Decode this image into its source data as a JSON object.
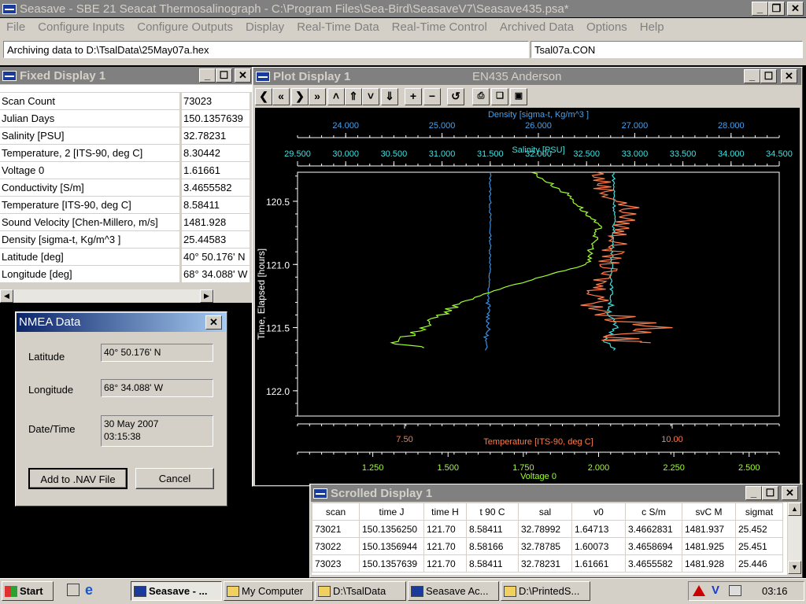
{
  "app": {
    "title": "Seasave - SBE 21 Seacat Thermosalinograph - C:\\Program Files\\Sea-Bird\\SeasaveV7\\Seasave435.psa*",
    "menus": [
      "File",
      "Configure Inputs",
      "Configure Outputs",
      "Display",
      "Real-Time Data",
      "Real-Time Control",
      "Archived Data",
      "Options",
      "Help"
    ],
    "status_left": "Archiving data to D:\\TsalData\\25May07a.hex",
    "status_right": "Tsal07a.CON"
  },
  "fixed_display": {
    "title": "Fixed Display 1",
    "rows": [
      {
        "label": "Scan Count",
        "value": "73023"
      },
      {
        "label": "Julian Days",
        "value": "150.1357639"
      },
      {
        "label": "Salinity [PSU]",
        "value": "32.78231"
      },
      {
        "label": "Temperature, 2 [ITS-90, deg C]",
        "value": "8.30442"
      },
      {
        "label": "Voltage 0",
        "value": "1.61661"
      },
      {
        "label": "Conductivity [S/m]",
        "value": "3.4655582"
      },
      {
        "label": "Temperature [ITS-90, deg C]",
        "value": "8.58411"
      },
      {
        "label": "Sound Velocity [Chen-Millero, m/s]",
        "value": "1481.928"
      },
      {
        "label": "Density [sigma-t, Kg/m^3 ]",
        "value": "25.44583"
      },
      {
        "label": "Latitude [deg]",
        "value": " 40° 50.176' N"
      },
      {
        "label": "Longitude [deg]",
        "value": " 68° 34.088' W"
      }
    ]
  },
  "nmea": {
    "title": "NMEA Data",
    "latitude_label": "Latitude",
    "latitude": "40° 50.176' N",
    "longitude_label": "Longitude",
    "longitude": "68° 34.088' W",
    "datetime_label": "Date/Time",
    "date": "30 May 2007",
    "time": "03:15:38",
    "add_button": "Add to .NAV File",
    "cancel_button": "Cancel"
  },
  "plot_display": {
    "title": "Plot Display 1",
    "subtitle": "EN435 Anderson",
    "toolbar": [
      "❮",
      "«",
      "❯",
      "»",
      "˄",
      "⇑",
      "˅",
      "⇓",
      "+",
      "−",
      "↺",
      "print",
      "copy",
      "save"
    ]
  },
  "chart_data": {
    "type": "line",
    "ylabel": "Time, Elapsed [hours]",
    "y_ticks": [
      "120.5",
      "121.0",
      "121.5",
      "122.0"
    ],
    "ylim": [
      120.27,
      122.2
    ],
    "y_inverted": true,
    "axes": [
      {
        "label": "Density [sigma-t, Kg/m^3 ]",
        "ticks": [
          "24.000",
          "25.000",
          "26.000",
          "27.000",
          "28.000"
        ],
        "range": [
          23.5,
          28.5
        ],
        "color": "#4aa0e8",
        "position": "top-outer"
      },
      {
        "label": "Salinity [PSU]",
        "ticks": [
          "29.500",
          "30.000",
          "30.500",
          "31.000",
          "31.500",
          "32.000",
          "32.500",
          "33.000",
          "33.500",
          "34.000",
          "34.500"
        ],
        "range": [
          29.5,
          34.5
        ],
        "color": "#40e0e0",
        "position": "top-inner"
      },
      {
        "label": "Temperature [ITS-90, deg C]",
        "ticks": [
          "7.50",
          "10.00"
        ],
        "range": [
          6.5,
          11.0
        ],
        "color": "#ff7b4a",
        "position": "bottom-inner"
      },
      {
        "label": "Voltage 0",
        "ticks": [
          "1.250",
          "1.500",
          "1.750",
          "2.000",
          "2.250",
          "2.500"
        ],
        "range": [
          1.0,
          2.6
        ],
        "color": "#a0ff30",
        "position": "bottom-outer"
      }
    ],
    "series": [
      {
        "name": "Density [sigma-t, Kg/m^3 ]",
        "color": "#3a8fe0",
        "points": [
          [
            25.5,
            120.27
          ],
          [
            25.5,
            120.6
          ],
          [
            25.5,
            121.0
          ],
          [
            25.48,
            121.22
          ],
          [
            25.48,
            121.38
          ],
          [
            25.48,
            121.5
          ],
          [
            25.45,
            121.6
          ],
          [
            25.45,
            121.68
          ]
        ]
      },
      {
        "name": "Salinity [PSU]",
        "color": "#40e0e0",
        "points": [
          [
            32.78,
            120.27
          ],
          [
            32.79,
            120.6
          ],
          [
            32.76,
            121.0
          ],
          [
            32.76,
            121.22
          ],
          [
            32.74,
            121.4
          ],
          [
            32.8,
            121.5
          ],
          [
            32.7,
            121.6
          ],
          [
            32.78,
            121.68
          ]
        ]
      },
      {
        "name": "Temperature [ITS-90, deg C]",
        "color": "#ff7b4a",
        "points": [
          [
            9.3,
            120.27
          ],
          [
            9.4,
            120.45
          ],
          [
            9.6,
            120.55
          ],
          [
            9.4,
            121.0
          ],
          [
            9.3,
            121.22
          ],
          [
            9.4,
            121.4
          ],
          [
            9.9,
            121.5
          ],
          [
            9.4,
            121.6
          ],
          [
            9.8,
            121.62
          ]
        ]
      },
      {
        "name": "Voltage 0",
        "color": "#a0ff30",
        "points": [
          [
            1.78,
            120.27
          ],
          [
            1.9,
            120.45
          ],
          [
            2.0,
            120.7
          ],
          [
            1.96,
            121.0
          ],
          [
            1.7,
            121.17
          ],
          [
            1.55,
            121.3
          ],
          [
            1.42,
            121.48
          ],
          [
            1.38,
            121.55
          ],
          [
            1.3,
            121.62
          ],
          [
            1.42,
            121.66
          ]
        ]
      }
    ]
  },
  "scrolled_display": {
    "title": "Scrolled Display 1",
    "columns": [
      "scan",
      "time J",
      "time H",
      "t 90 C",
      "sal",
      "v0",
      "c S/m",
      "svC M",
      "sigmat"
    ],
    "rows": [
      [
        "73021",
        "150.1356250",
        "121.70",
        "8.58411",
        "32.78992",
        "1.64713",
        "3.4662831",
        "1481.937",
        "25.452"
      ],
      [
        "73022",
        "150.1356944",
        "121.70",
        "8.58166",
        "32.78785",
        "1.60073",
        "3.4658694",
        "1481.925",
        "25.451"
      ],
      [
        "73023",
        "150.1357639",
        "121.70",
        "8.58411",
        "32.78231",
        "1.61661",
        "3.4655582",
        "1481.928",
        "25.446"
      ]
    ]
  },
  "taskbar": {
    "start": "Start",
    "buttons": [
      "Seasave - ...",
      "My Computer",
      "D:\\TsalData",
      "Seasave Ac...",
      "D:\\PrintedS..."
    ],
    "clock": "03:16"
  }
}
